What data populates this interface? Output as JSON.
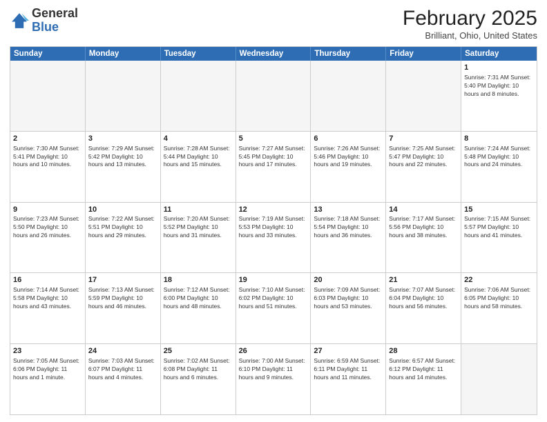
{
  "logo": {
    "general": "General",
    "blue": "Blue"
  },
  "header": {
    "month": "February 2025",
    "location": "Brilliant, Ohio, United States"
  },
  "weekdays": [
    "Sunday",
    "Monday",
    "Tuesday",
    "Wednesday",
    "Thursday",
    "Friday",
    "Saturday"
  ],
  "rows": [
    [
      {
        "day": "",
        "info": ""
      },
      {
        "day": "",
        "info": ""
      },
      {
        "day": "",
        "info": ""
      },
      {
        "day": "",
        "info": ""
      },
      {
        "day": "",
        "info": ""
      },
      {
        "day": "",
        "info": ""
      },
      {
        "day": "1",
        "info": "Sunrise: 7:31 AM\nSunset: 5:40 PM\nDaylight: 10 hours and 8 minutes."
      }
    ],
    [
      {
        "day": "2",
        "info": "Sunrise: 7:30 AM\nSunset: 5:41 PM\nDaylight: 10 hours and 10 minutes."
      },
      {
        "day": "3",
        "info": "Sunrise: 7:29 AM\nSunset: 5:42 PM\nDaylight: 10 hours and 13 minutes."
      },
      {
        "day": "4",
        "info": "Sunrise: 7:28 AM\nSunset: 5:44 PM\nDaylight: 10 hours and 15 minutes."
      },
      {
        "day": "5",
        "info": "Sunrise: 7:27 AM\nSunset: 5:45 PM\nDaylight: 10 hours and 17 minutes."
      },
      {
        "day": "6",
        "info": "Sunrise: 7:26 AM\nSunset: 5:46 PM\nDaylight: 10 hours and 19 minutes."
      },
      {
        "day": "7",
        "info": "Sunrise: 7:25 AM\nSunset: 5:47 PM\nDaylight: 10 hours and 22 minutes."
      },
      {
        "day": "8",
        "info": "Sunrise: 7:24 AM\nSunset: 5:48 PM\nDaylight: 10 hours and 24 minutes."
      }
    ],
    [
      {
        "day": "9",
        "info": "Sunrise: 7:23 AM\nSunset: 5:50 PM\nDaylight: 10 hours and 26 minutes."
      },
      {
        "day": "10",
        "info": "Sunrise: 7:22 AM\nSunset: 5:51 PM\nDaylight: 10 hours and 29 minutes."
      },
      {
        "day": "11",
        "info": "Sunrise: 7:20 AM\nSunset: 5:52 PM\nDaylight: 10 hours and 31 minutes."
      },
      {
        "day": "12",
        "info": "Sunrise: 7:19 AM\nSunset: 5:53 PM\nDaylight: 10 hours and 33 minutes."
      },
      {
        "day": "13",
        "info": "Sunrise: 7:18 AM\nSunset: 5:54 PM\nDaylight: 10 hours and 36 minutes."
      },
      {
        "day": "14",
        "info": "Sunrise: 7:17 AM\nSunset: 5:56 PM\nDaylight: 10 hours and 38 minutes."
      },
      {
        "day": "15",
        "info": "Sunrise: 7:15 AM\nSunset: 5:57 PM\nDaylight: 10 hours and 41 minutes."
      }
    ],
    [
      {
        "day": "16",
        "info": "Sunrise: 7:14 AM\nSunset: 5:58 PM\nDaylight: 10 hours and 43 minutes."
      },
      {
        "day": "17",
        "info": "Sunrise: 7:13 AM\nSunset: 5:59 PM\nDaylight: 10 hours and 46 minutes."
      },
      {
        "day": "18",
        "info": "Sunrise: 7:12 AM\nSunset: 6:00 PM\nDaylight: 10 hours and 48 minutes."
      },
      {
        "day": "19",
        "info": "Sunrise: 7:10 AM\nSunset: 6:02 PM\nDaylight: 10 hours and 51 minutes."
      },
      {
        "day": "20",
        "info": "Sunrise: 7:09 AM\nSunset: 6:03 PM\nDaylight: 10 hours and 53 minutes."
      },
      {
        "day": "21",
        "info": "Sunrise: 7:07 AM\nSunset: 6:04 PM\nDaylight: 10 hours and 56 minutes."
      },
      {
        "day": "22",
        "info": "Sunrise: 7:06 AM\nSunset: 6:05 PM\nDaylight: 10 hours and 58 minutes."
      }
    ],
    [
      {
        "day": "23",
        "info": "Sunrise: 7:05 AM\nSunset: 6:06 PM\nDaylight: 11 hours and 1 minute."
      },
      {
        "day": "24",
        "info": "Sunrise: 7:03 AM\nSunset: 6:07 PM\nDaylight: 11 hours and 4 minutes."
      },
      {
        "day": "25",
        "info": "Sunrise: 7:02 AM\nSunset: 6:08 PM\nDaylight: 11 hours and 6 minutes."
      },
      {
        "day": "26",
        "info": "Sunrise: 7:00 AM\nSunset: 6:10 PM\nDaylight: 11 hours and 9 minutes."
      },
      {
        "day": "27",
        "info": "Sunrise: 6:59 AM\nSunset: 6:11 PM\nDaylight: 11 hours and 11 minutes."
      },
      {
        "day": "28",
        "info": "Sunrise: 6:57 AM\nSunset: 6:12 PM\nDaylight: 11 hours and 14 minutes."
      },
      {
        "day": "",
        "info": ""
      }
    ]
  ]
}
